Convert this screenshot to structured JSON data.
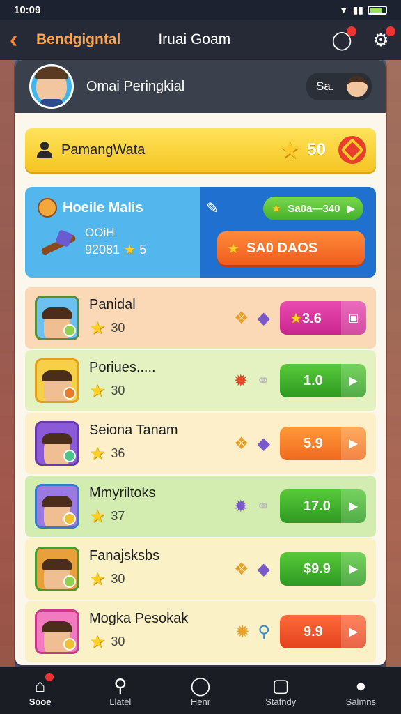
{
  "status": {
    "time": "10:09"
  },
  "header": {
    "brand": "Bendgigntal",
    "title": "Iruai Goam"
  },
  "profile": {
    "name": "Omai Peringkial",
    "pill_text": "Sa."
  },
  "highlight": {
    "name": "PamangWata",
    "value": "50"
  },
  "event": {
    "title": "Hoeile Malis",
    "sub1": "OOiH",
    "sub2_value": "92081",
    "sub2_count": "5",
    "green_button": "Sa0a—340",
    "orange_button": "SA0 DAOS"
  },
  "rows": [
    {
      "name": "Panidal",
      "score": "30",
      "button": "3.6"
    },
    {
      "name": "Poriues.....",
      "score": "30",
      "button": "1.0"
    },
    {
      "name": "Seiona Tanam",
      "score": "36",
      "button": "5.9"
    },
    {
      "name": "Mmyriltoks",
      "score": "37",
      "button": "17.0"
    },
    {
      "name": "Fanajsksbs",
      "score": "30",
      "button": "$9.9"
    },
    {
      "name": "Mogka Pesokak",
      "score": "30",
      "button": "9.9"
    }
  ],
  "nav": [
    {
      "label": "Sooe",
      "icon": "home-icon"
    },
    {
      "label": "Llatel",
      "icon": "search-icon"
    },
    {
      "label": "Henr",
      "icon": "circle-icon"
    },
    {
      "label": "Stafndy",
      "icon": "square-icon"
    },
    {
      "label": "Salmns",
      "icon": "profile-icon"
    }
  ]
}
